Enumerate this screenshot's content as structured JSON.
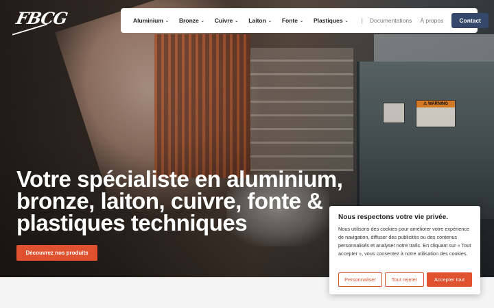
{
  "brand": {
    "logo_text": "FBCG"
  },
  "nav": {
    "items": [
      {
        "label": "Aluminium"
      },
      {
        "label": "Bronze"
      },
      {
        "label": "Cuivre"
      },
      {
        "label": "Laiton"
      },
      {
        "label": "Fonte"
      },
      {
        "label": "Plastiques"
      }
    ],
    "separator": "|",
    "links": [
      {
        "label": "Documentations"
      },
      {
        "label": "À propos"
      }
    ],
    "contact_label": "Contact"
  },
  "hero": {
    "headline_lines": [
      "Votre spécialiste en aluminium,",
      "bronze, laiton, cuivre, fonte &",
      "plastiques techniques"
    ],
    "cta_label": "Découvrez nos produits",
    "warning_text": "WARNING"
  },
  "cookie": {
    "title": "Nous respectons votre vie privée.",
    "text": "Nous utilisons des cookies pour améliorer votre expérience de navigation, diffuser des publicités ou des contenus personnalisés et analyser notre trafic. En cliquant sur « Tout accepter », vous consentez à notre utilisation des cookies.",
    "customize_label": "Personnaliser",
    "reject_label": "Tout rejeter",
    "accept_label": "Accepter tout"
  },
  "colors": {
    "accent": "#e0512f",
    "contact_button": "#33486b",
    "page_background": "#f4f4f4"
  },
  "icons": {
    "chevron": "chevron-down-icon"
  }
}
